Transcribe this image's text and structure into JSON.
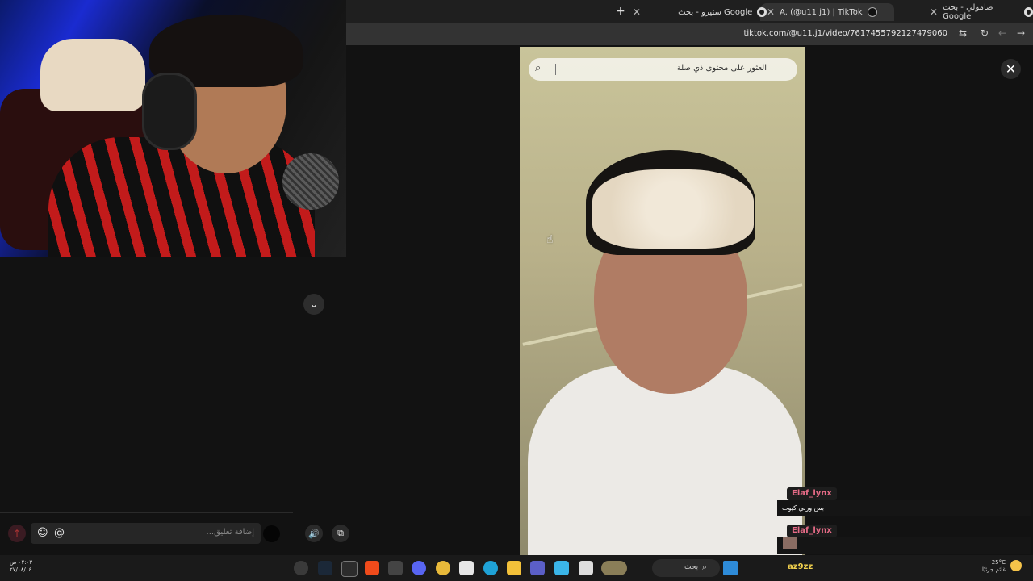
{
  "browser": {
    "tabs": [
      {
        "label": "صامولي - بحث Google",
        "favicon": "google-icon"
      },
      {
        "label": "A. (@u11.j1) | TikTok",
        "favicon": "tiktok-icon",
        "active": true
      },
      {
        "label": "ستيرو - بحث Google",
        "favicon": "google-icon"
      }
    ],
    "new_tab_label": "+",
    "url": "tiktok.com/@u11.j1/video/7617455792127479060"
  },
  "video_view": {
    "search_placeholder": "العثور على محتوى ذي صلة",
    "close_label": "✕"
  },
  "comment_box": {
    "placeholder": "إضافة تعليق...",
    "mention_symbol": "@",
    "emoji_symbol": "☺"
  },
  "chat": [
    {
      "user": "Elaf_lynx",
      "message": "بس وربي كيوت"
    },
    {
      "user": "Elaf_lynx",
      "message": ""
    }
  ],
  "taskbar": {
    "clock_time": "٠٢:٠٣ ص",
    "clock_date": "٢٧/٠٨/٠٤",
    "search_label": "بحث",
    "brand": "az9zz",
    "weather_temp": "25°C",
    "weather_desc": "غائم جزئيًا"
  },
  "colors": {
    "chat_username": "#e76b87",
    "brand_yellow": "#f3d24e",
    "tab_bg": "#1f1f1f",
    "address_bg": "#333333"
  }
}
